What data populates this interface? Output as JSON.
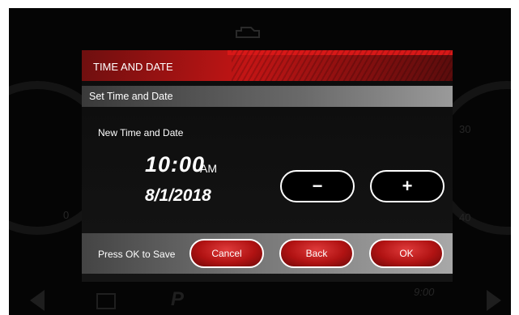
{
  "dialog": {
    "title": "TIME AND DATE",
    "subtitle": "Set Time and Date",
    "field_label": "New Time and Date",
    "time": "10:00",
    "ampm": "AM",
    "date": "8/1/2018"
  },
  "steppers": {
    "decrement_label": "−",
    "increment_label": "+"
  },
  "footer": {
    "prompt": "Press OK to Save",
    "cancel_label": "Cancel",
    "back_label": "Back",
    "ok_label": "OK"
  },
  "background": {
    "left_gauge_label": "0",
    "right_gauge_top": "30",
    "right_gauge_bottom": "40",
    "bottom_clock": "9:00"
  },
  "colors": {
    "title_red": "#c31515",
    "button_red": "#b11313",
    "screen_bg": "#050505"
  }
}
